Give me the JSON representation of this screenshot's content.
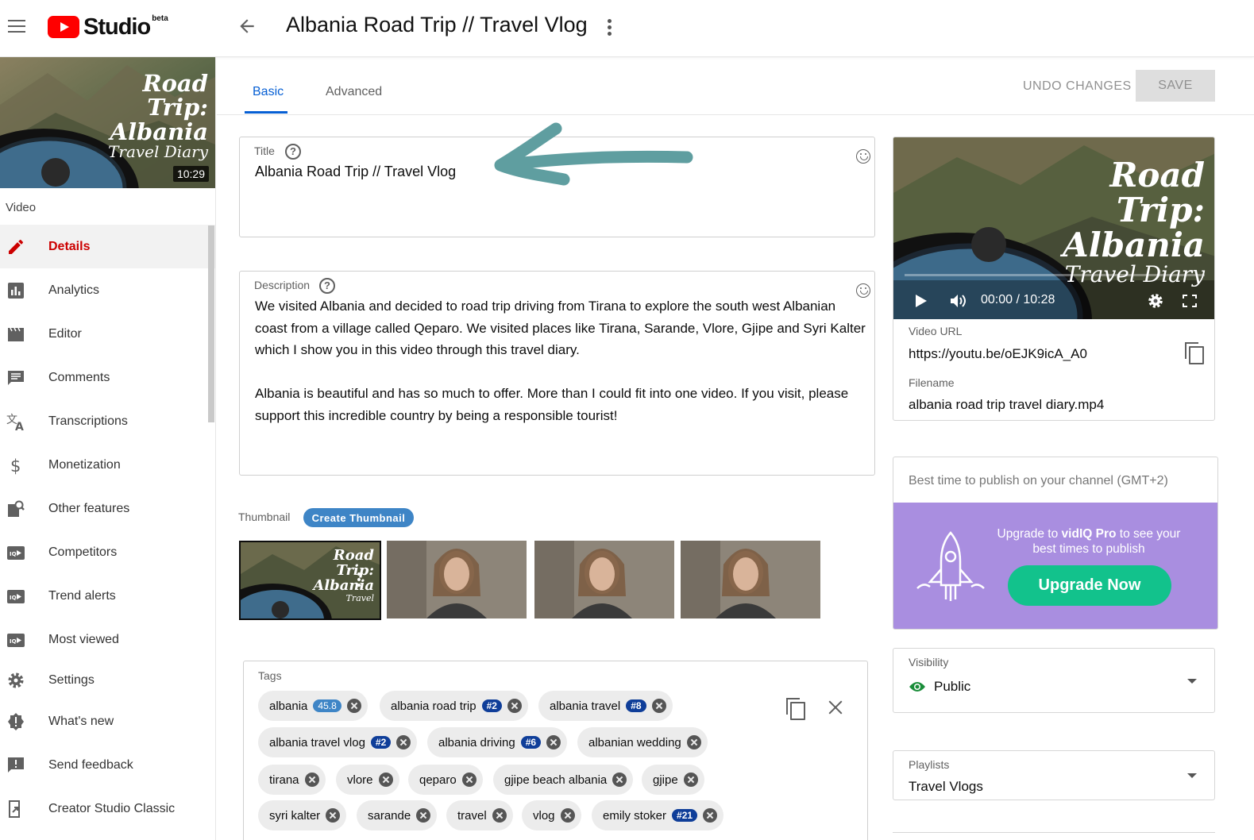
{
  "header": {
    "logo_text": "Studio",
    "logo_badge": "beta",
    "title": "Albania Road Trip // Travel Vlog"
  },
  "sidebar": {
    "thumbnail_overlay": [
      "Road Trip:",
      "Albania",
      "Travel Diary"
    ],
    "duration": "10:29",
    "section_label": "Video",
    "items": [
      {
        "label": "Details",
        "icon": "pencil-icon",
        "active": true
      },
      {
        "label": "Analytics",
        "icon": "analytics-icon"
      },
      {
        "label": "Editor",
        "icon": "clapperboard-icon"
      },
      {
        "label": "Comments",
        "icon": "comment-icon"
      },
      {
        "label": "Transcriptions",
        "icon": "translate-icon"
      },
      {
        "label": "Monetization",
        "icon": "dollar-icon"
      },
      {
        "label": "Other features",
        "icon": "features-icon"
      },
      {
        "label": "Competitors",
        "icon": "vidiq-icon"
      },
      {
        "label": "Trend alerts",
        "icon": "vidiq-icon"
      },
      {
        "label": "Most viewed",
        "icon": "vidiq-icon"
      },
      {
        "label": "Settings",
        "icon": "gear-icon"
      },
      {
        "label": "What's new",
        "icon": "alert-badge-icon"
      },
      {
        "label": "Send feedback",
        "icon": "feedback-icon"
      },
      {
        "label": "Creator Studio Classic",
        "icon": "classic-icon"
      }
    ]
  },
  "tabs": [
    {
      "label": "Basic",
      "active": true
    },
    {
      "label": "Advanced"
    }
  ],
  "actions": {
    "undo_label": "UNDO CHANGES",
    "save_label": "SAVE"
  },
  "title_field": {
    "label": "Title",
    "value": "Albania Road Trip // Travel Vlog"
  },
  "description_field": {
    "label": "Description",
    "paragraphs": [
      "We visited Albania and decided to road trip driving from Tirana to explore the south west Albanian coast from a village called Qeparo. We visited places like Tirana, Sarande, Vlore, Gjipe and Syri Kalter which I show you in this video through this travel diary.",
      "Albania is beautiful and has so much to offer. More than I could fit into one video. If you visit, please support this incredible country by being a responsible tourist!"
    ]
  },
  "thumbnail": {
    "label": "Thumbnail",
    "create_label": "Create Thumbnail",
    "selected_overlay": [
      "Road Trip:",
      "Albania",
      "Travel"
    ]
  },
  "tags": {
    "label": "Tags",
    "items": [
      {
        "text": "albania",
        "badge": "45.8",
        "badge_style": "light"
      },
      {
        "text": "albania road trip",
        "badge": "#2"
      },
      {
        "text": "albania travel",
        "badge": "#8"
      },
      {
        "text": "albania travel vlog",
        "badge": "#2"
      },
      {
        "text": "albania driving",
        "badge": "#6"
      },
      {
        "text": "albanian wedding"
      },
      {
        "text": "tirana"
      },
      {
        "text": "vlore"
      },
      {
        "text": "qeparo"
      },
      {
        "text": "gjipe beach albania"
      },
      {
        "text": "gjipe"
      },
      {
        "text": "syri kalter"
      },
      {
        "text": "sarande"
      },
      {
        "text": "travel"
      },
      {
        "text": "vlog"
      },
      {
        "text": "emily stoker",
        "badge": "#21"
      }
    ]
  },
  "video_card": {
    "overlay": [
      "Road Trip:",
      "Albania",
      "Travel Diary"
    ],
    "time": "00:00 / 10:28",
    "url_label": "Video URL",
    "url": "https://youtu.be/oEJK9icA_A0",
    "filename_label": "Filename",
    "filename": "albania road trip travel diary.mp4"
  },
  "best_time": {
    "header": "Best time to publish on your channel (GMT+2)",
    "promo_prefix": "Upgrade to ",
    "promo_brand": "vidIQ Pro",
    "promo_suffix": " to see your best times to publish",
    "button": "Upgrade Now"
  },
  "visibility": {
    "label": "Visibility",
    "value": "Public"
  },
  "playlists": {
    "label": "Playlists",
    "value": "Travel Vlogs"
  },
  "colors": {
    "accent_blue": "#065fd4",
    "active_red": "#cc0000",
    "promo_purple": "#a98ee0",
    "upgrade_green": "#12c28c",
    "tag_badge": "#0f3e99",
    "annotation_arrow": "#5f9ea0"
  }
}
